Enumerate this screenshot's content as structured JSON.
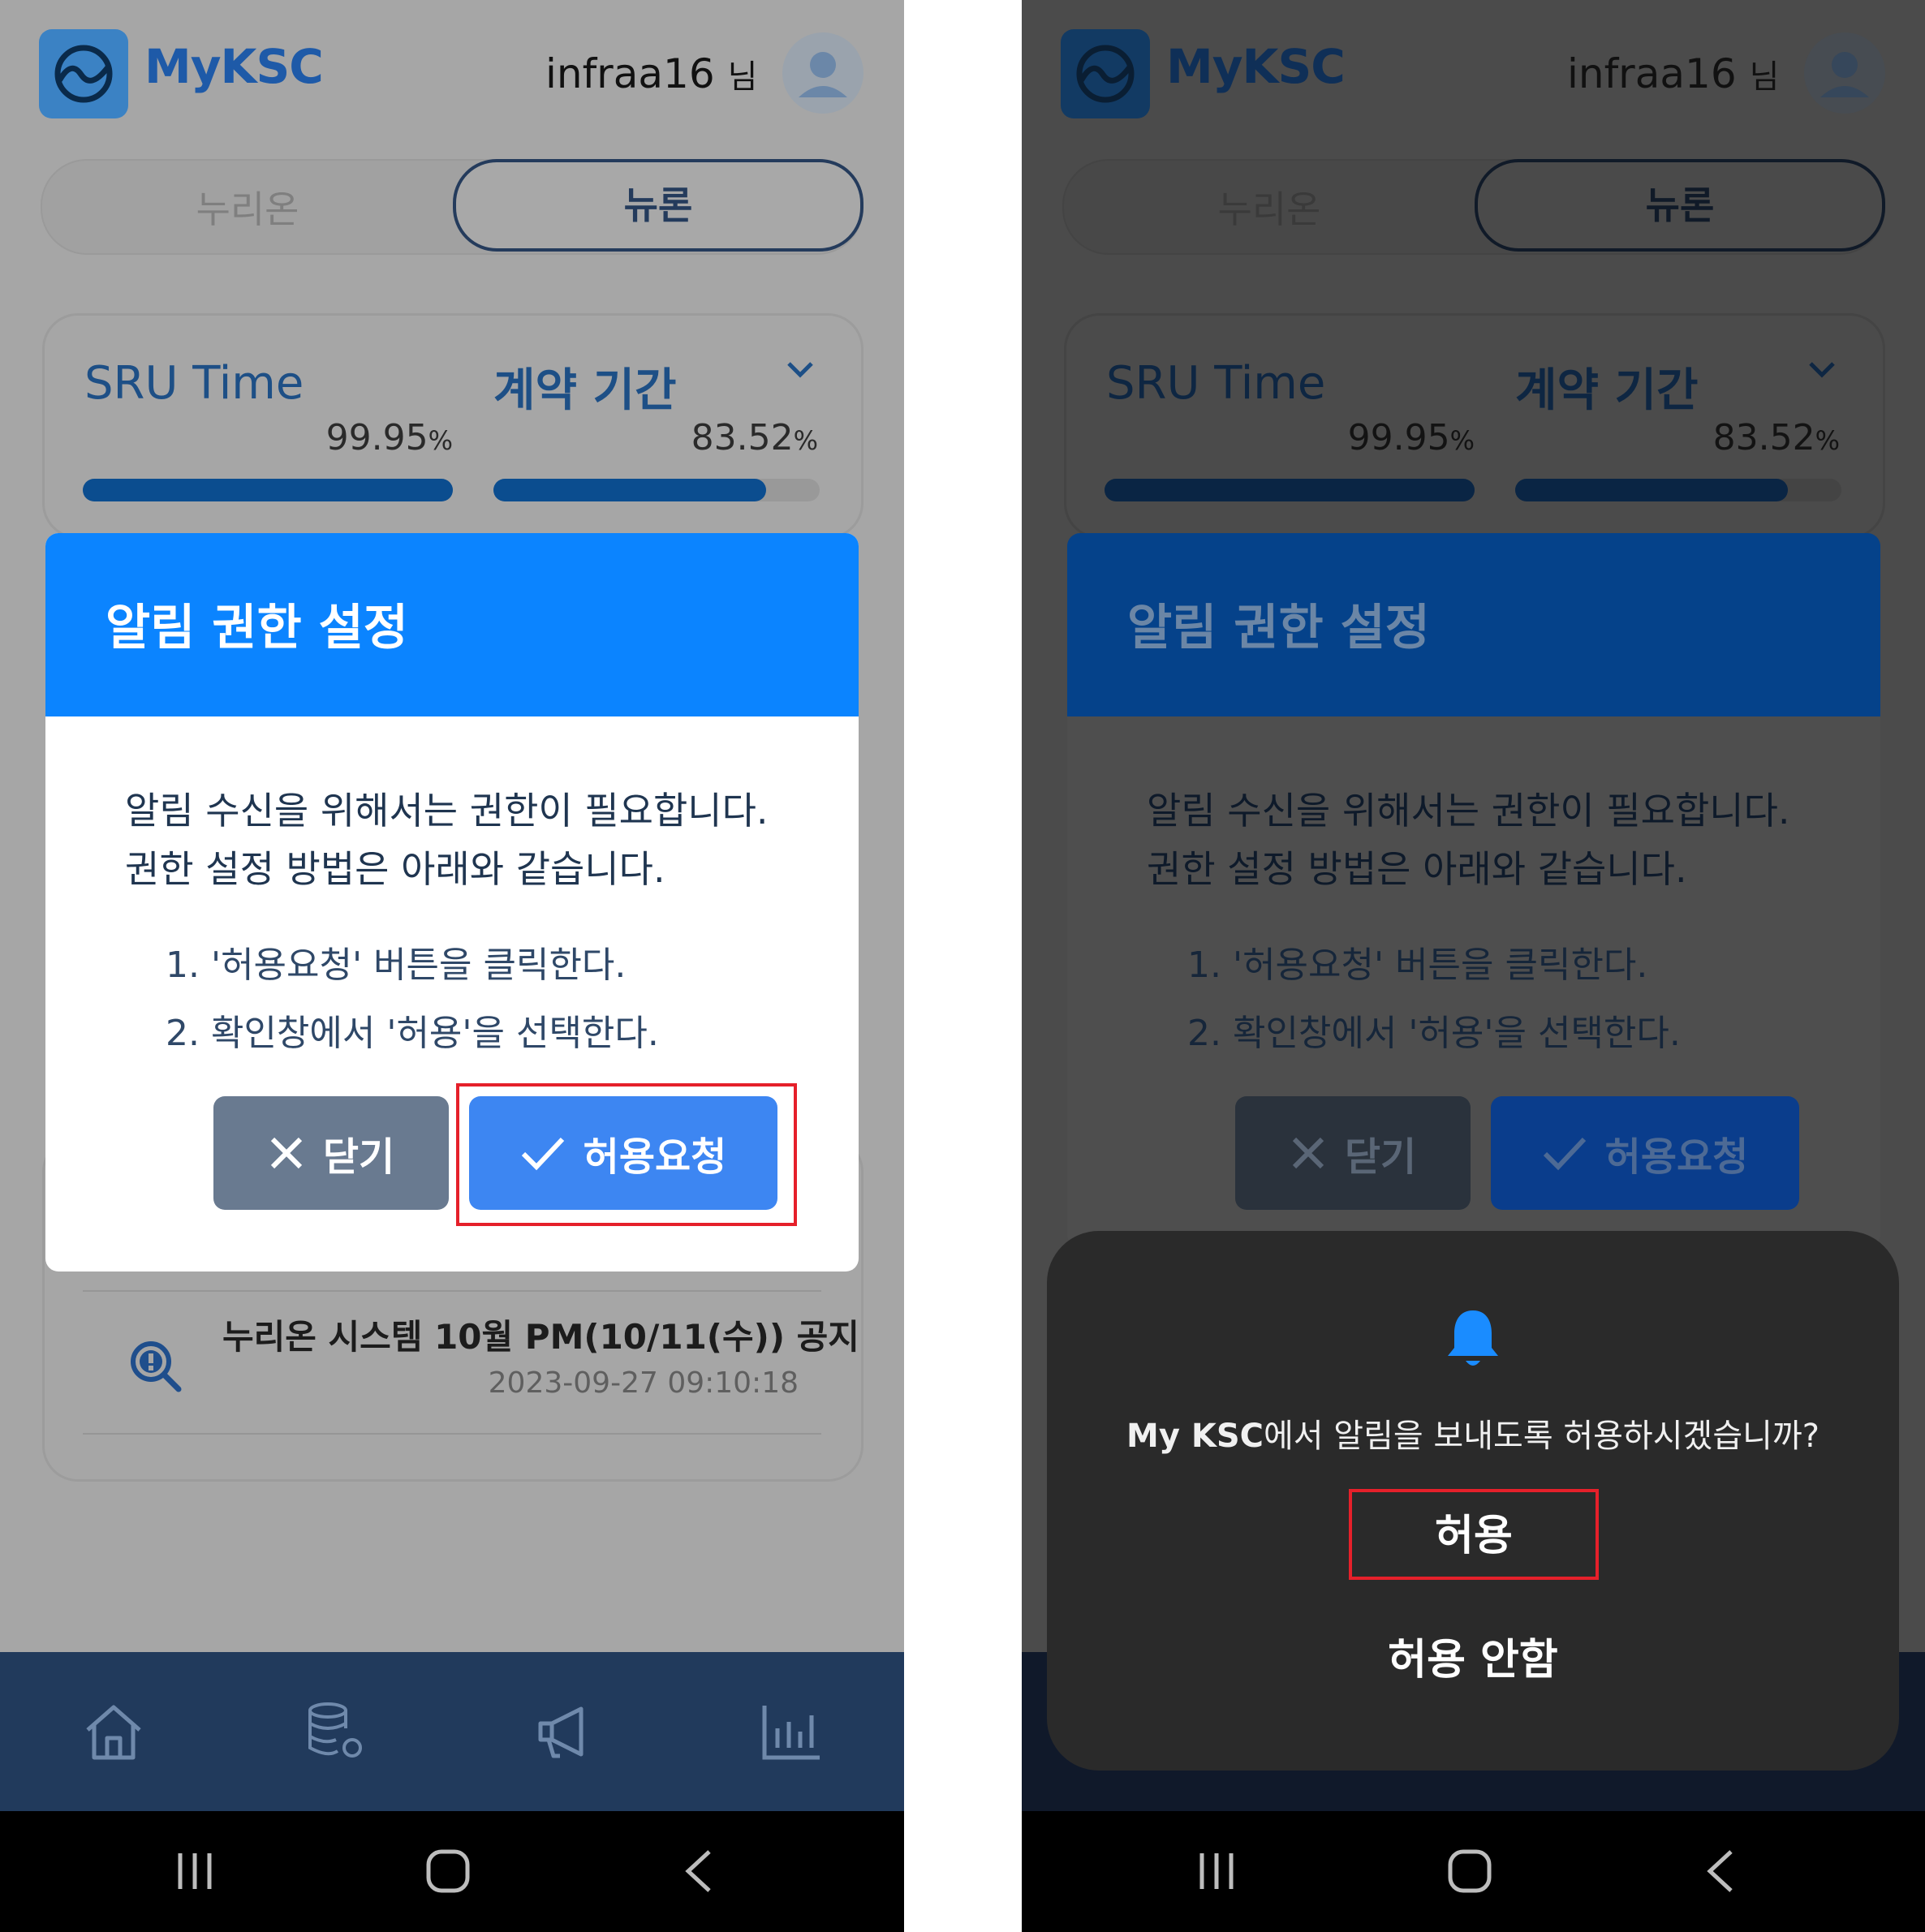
{
  "header": {
    "app_name": "MyKSC",
    "username": "infraa16",
    "honorific": "님"
  },
  "segment": {
    "left": "누리온",
    "right": "뉴론"
  },
  "metrics": {
    "sru": {
      "title": "SRU Time",
      "value": "99.95",
      "unit": "%",
      "progress": 0.9995
    },
    "contract": {
      "title": "계약 기간",
      "value": "83.52",
      "unit": "%",
      "progress": 0.8352
    }
  },
  "notice": {
    "title": "누리온 시스템 10월 PM(10/11(수)) 공지",
    "date": "2023-09-27 09:10:18"
  },
  "dialog": {
    "title": "알림 권한 설정",
    "line1": "알림 수신을 위해서는 권한이 필요합니다.",
    "line2": "권한 설정 방법은 아래와 같습니다.",
    "step1": "1. '허용요청' 버튼을 클릭한다.",
    "step2": "2. 확인창에서 '허용'을 선택한다.",
    "close_label": "닫기",
    "request_label": "허용요청"
  },
  "permission_sheet": {
    "app_label": "My KSC",
    "question": "에서 알림을 보내도록 허용하시겠습니까?",
    "allow_label": "허용",
    "deny_label": "허용 안함"
  },
  "colors": {
    "accent_blue": "#0b84ff",
    "button_blue": "#3d86f2",
    "button_gray": "#697a90",
    "nav_bg": "#213a5c",
    "highlight_red": "#e5202a"
  },
  "icons": {
    "nav": [
      "home-icon",
      "database-settings-icon",
      "megaphone-icon",
      "bar-chart-icon"
    ],
    "system": [
      "recent-apps-icon",
      "home-button-icon",
      "back-icon"
    ]
  }
}
